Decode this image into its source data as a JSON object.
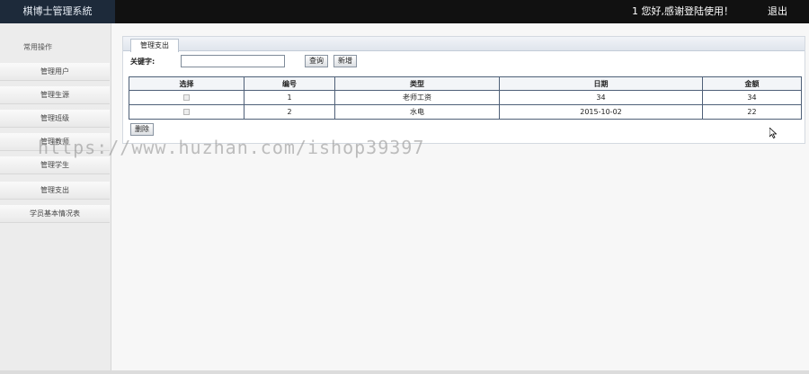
{
  "header": {
    "app_title": "棋博士管理系統",
    "greeting": "1 您好,感谢登陆使用！",
    "logout_label": "退出"
  },
  "sidebar": {
    "heading": "常用操作",
    "items": [
      {
        "label": "管理用户"
      },
      {
        "label": "管理生源"
      },
      {
        "label": "管理班级"
      },
      {
        "label": "管理教师"
      },
      {
        "label": "管理学生"
      },
      {
        "label": "管理支出"
      },
      {
        "label": "学员基本情况表"
      }
    ]
  },
  "main": {
    "tab_label": "管理支出",
    "search": {
      "label": "关键字:",
      "value": "",
      "placeholder": ""
    },
    "query_label": "查询",
    "add_label": "新增",
    "delete_label": "删除",
    "table": {
      "columns": [
        "选择",
        "编号",
        "类型",
        "日期",
        "金额"
      ],
      "rows": [
        {
          "id": "1",
          "type": "老师工资",
          "date": "34",
          "amount": "34"
        },
        {
          "id": "2",
          "type": "水电",
          "date": "2015-10-02",
          "amount": "22"
        }
      ]
    }
  },
  "watermark": "https://www.huzhan.com/ishop39397",
  "colors": {
    "topbar": "#111111",
    "logo_bg": "#1d2a3a",
    "table_border": "#4f6078"
  }
}
